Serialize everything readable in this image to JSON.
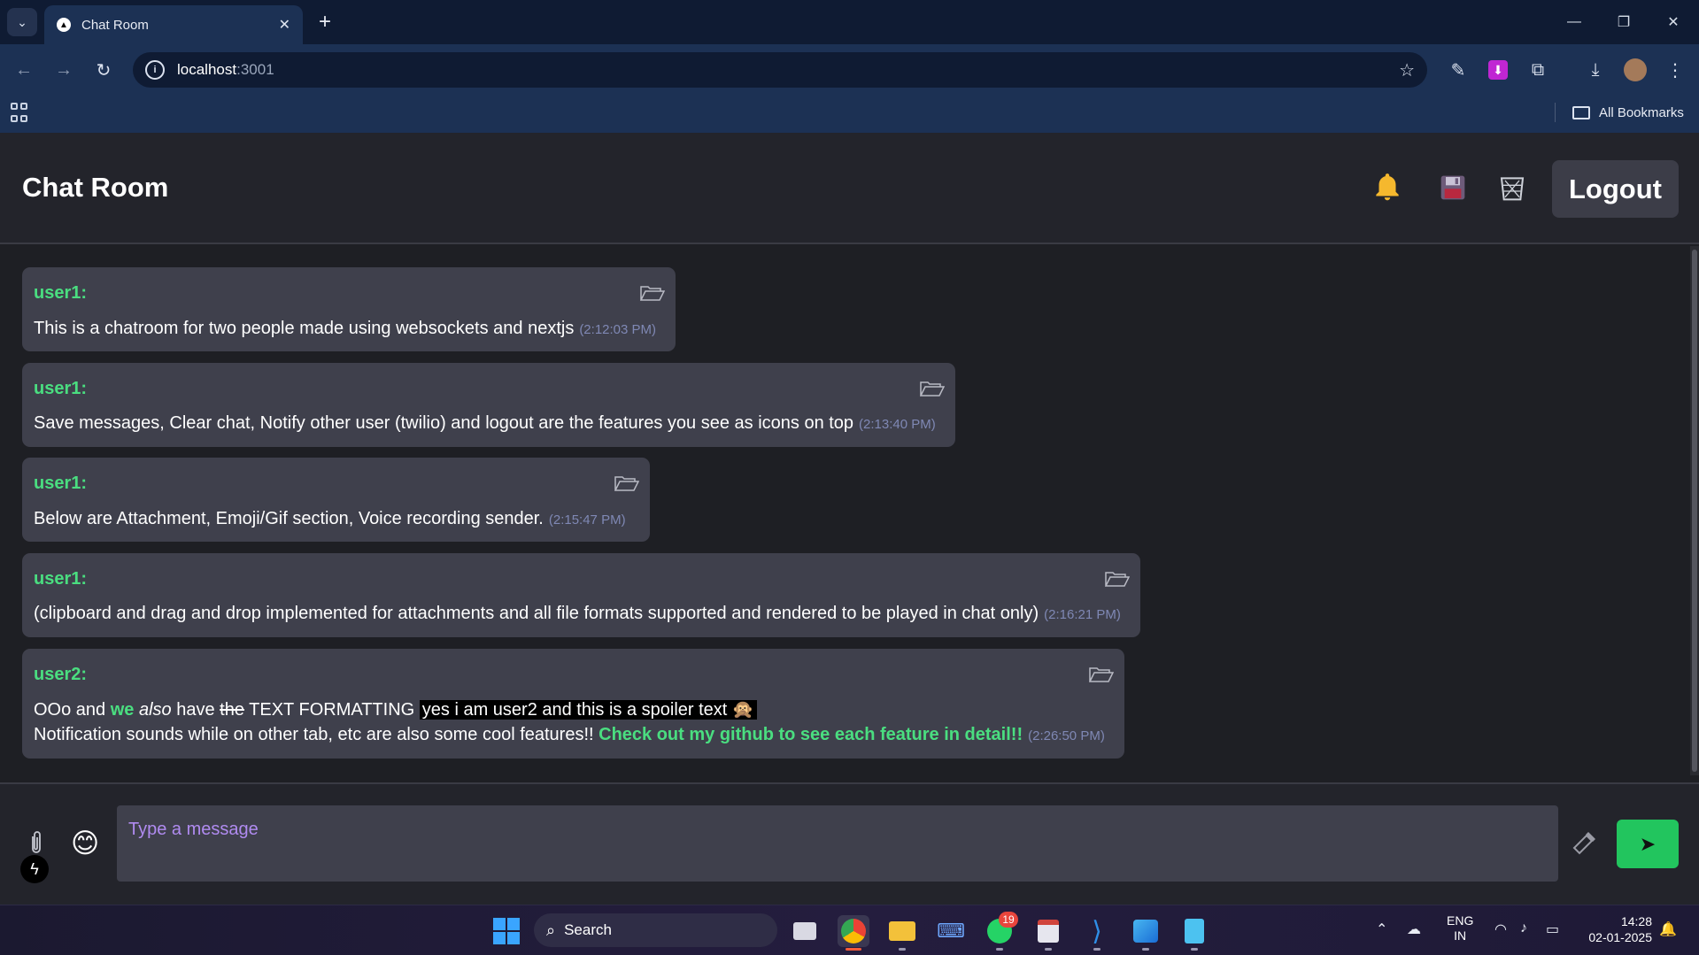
{
  "browser": {
    "tab_title": "Chat Room",
    "url_host": "localhost",
    "url_port": ":3001",
    "all_bookmarks": "All Bookmarks"
  },
  "app": {
    "title": "Chat Room",
    "logout_label": "Logout",
    "icons": [
      "bell-icon",
      "save-icon",
      "trash-icon"
    ]
  },
  "messages": [
    {
      "user": "user1:",
      "text": "This is a chatroom for two people made using websockets and nextjs",
      "time": "(2:12:03 PM)"
    },
    {
      "user": "user1:",
      "text": "Save messages, Clear chat, Notify other user (twilio) and logout are the features you see as icons on top",
      "time": "(2:13:40 PM)"
    },
    {
      "user": "user1:",
      "text": "Below are Attachment, Emoji/Gif section, Voice recording sender.",
      "time": "(2:15:47 PM)"
    },
    {
      "user": "user1:",
      "text": "(clipboard and drag and drop implemented for attachments and all file formats supported and rendered to be played in chat only)",
      "time": "(2:16:21 PM)"
    },
    {
      "user": "user2:",
      "line1": {
        "p1": "OOo and ",
        "we": "we",
        "also": "also",
        "have": " have ",
        "the": "the",
        "rest": " TEXT FORMATTING ",
        "spoiler": "yes i am user2 and this is a spoiler text 🙊"
      },
      "line2": {
        "text": "Notification sounds while on other tab, etc are also some cool features!! ",
        "link": "Check out my github to see each feature in detail!!"
      },
      "time": "(2:26:50 PM)"
    }
  ],
  "composer": {
    "placeholder": "Type a message"
  },
  "taskbar": {
    "search_label": "Search",
    "whatsapp_badge": "19",
    "lang_line1": "ENG",
    "lang_line2": "IN",
    "time": "14:28",
    "date": "02-01-2025"
  },
  "colors": {
    "accent_green": "#4ade80",
    "send_green": "#22c55e",
    "message_bg": "#3f404c",
    "timestamp": "#7f88b4"
  }
}
